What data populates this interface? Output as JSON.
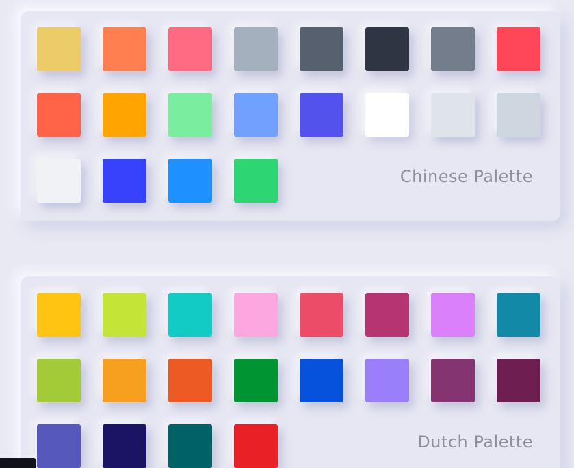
{
  "palettes": [
    {
      "name": "Chinese Palette",
      "colors": [
        "#eccc68",
        "#ff7f50",
        "#ff6b81",
        "#a4b0be",
        "#57606f",
        "#2f3542",
        "#747d8c",
        "#ff4757",
        "#ff6348",
        "#ffa502",
        "#7bed9f",
        "#70a1ff",
        "#5352ed",
        "#ffffff",
        "#dfe4ea",
        "#ced6e0",
        "#f1f2f6",
        "#3742fa",
        "#1e90ff",
        "#2ed573"
      ]
    },
    {
      "name": "Dutch Palette",
      "colors": [
        "#ffc312",
        "#c4e538",
        "#12cbc4",
        "#fda7df",
        "#ed4c67",
        "#b53471",
        "#d980fa",
        "#1289a7",
        "#a3cb38",
        "#f79f1f",
        "#ee5a24",
        "#009432",
        "#0652dd",
        "#9980fa",
        "#833471",
        "#6f1e51",
        "#5758bb",
        "#1b1464",
        "#006266",
        "#ea2027"
      ]
    }
  ]
}
